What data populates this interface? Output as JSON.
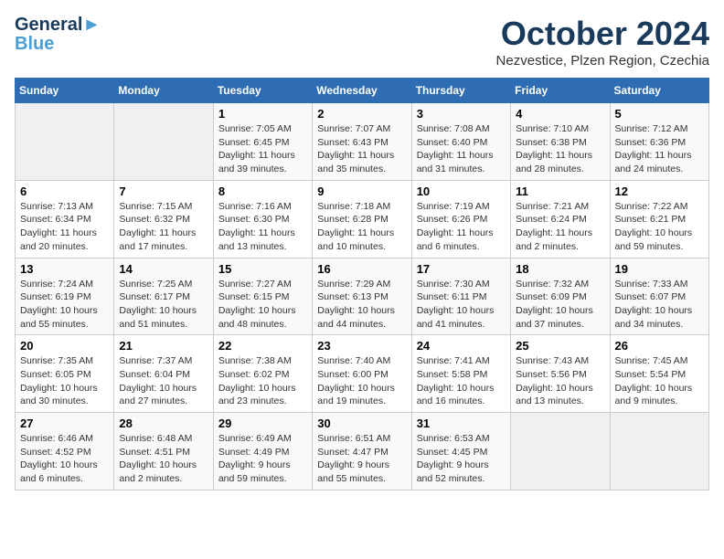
{
  "header": {
    "logo_line1": "General",
    "logo_line2": "Blue",
    "month": "October 2024",
    "location": "Nezvestice, Plzen Region, Czechia"
  },
  "weekdays": [
    "Sunday",
    "Monday",
    "Tuesday",
    "Wednesday",
    "Thursday",
    "Friday",
    "Saturday"
  ],
  "weeks": [
    [
      {
        "day": null
      },
      {
        "day": null
      },
      {
        "day": "1",
        "sunrise": "Sunrise: 7:05 AM",
        "sunset": "Sunset: 6:45 PM",
        "daylight": "Daylight: 11 hours and 39 minutes."
      },
      {
        "day": "2",
        "sunrise": "Sunrise: 7:07 AM",
        "sunset": "Sunset: 6:43 PM",
        "daylight": "Daylight: 11 hours and 35 minutes."
      },
      {
        "day": "3",
        "sunrise": "Sunrise: 7:08 AM",
        "sunset": "Sunset: 6:40 PM",
        "daylight": "Daylight: 11 hours and 31 minutes."
      },
      {
        "day": "4",
        "sunrise": "Sunrise: 7:10 AM",
        "sunset": "Sunset: 6:38 PM",
        "daylight": "Daylight: 11 hours and 28 minutes."
      },
      {
        "day": "5",
        "sunrise": "Sunrise: 7:12 AM",
        "sunset": "Sunset: 6:36 PM",
        "daylight": "Daylight: 11 hours and 24 minutes."
      }
    ],
    [
      {
        "day": "6",
        "sunrise": "Sunrise: 7:13 AM",
        "sunset": "Sunset: 6:34 PM",
        "daylight": "Daylight: 11 hours and 20 minutes."
      },
      {
        "day": "7",
        "sunrise": "Sunrise: 7:15 AM",
        "sunset": "Sunset: 6:32 PM",
        "daylight": "Daylight: 11 hours and 17 minutes."
      },
      {
        "day": "8",
        "sunrise": "Sunrise: 7:16 AM",
        "sunset": "Sunset: 6:30 PM",
        "daylight": "Daylight: 11 hours and 13 minutes."
      },
      {
        "day": "9",
        "sunrise": "Sunrise: 7:18 AM",
        "sunset": "Sunset: 6:28 PM",
        "daylight": "Daylight: 11 hours and 10 minutes."
      },
      {
        "day": "10",
        "sunrise": "Sunrise: 7:19 AM",
        "sunset": "Sunset: 6:26 PM",
        "daylight": "Daylight: 11 hours and 6 minutes."
      },
      {
        "day": "11",
        "sunrise": "Sunrise: 7:21 AM",
        "sunset": "Sunset: 6:24 PM",
        "daylight": "Daylight: 11 hours and 2 minutes."
      },
      {
        "day": "12",
        "sunrise": "Sunrise: 7:22 AM",
        "sunset": "Sunset: 6:21 PM",
        "daylight": "Daylight: 10 hours and 59 minutes."
      }
    ],
    [
      {
        "day": "13",
        "sunrise": "Sunrise: 7:24 AM",
        "sunset": "Sunset: 6:19 PM",
        "daylight": "Daylight: 10 hours and 55 minutes."
      },
      {
        "day": "14",
        "sunrise": "Sunrise: 7:25 AM",
        "sunset": "Sunset: 6:17 PM",
        "daylight": "Daylight: 10 hours and 51 minutes."
      },
      {
        "day": "15",
        "sunrise": "Sunrise: 7:27 AM",
        "sunset": "Sunset: 6:15 PM",
        "daylight": "Daylight: 10 hours and 48 minutes."
      },
      {
        "day": "16",
        "sunrise": "Sunrise: 7:29 AM",
        "sunset": "Sunset: 6:13 PM",
        "daylight": "Daylight: 10 hours and 44 minutes."
      },
      {
        "day": "17",
        "sunrise": "Sunrise: 7:30 AM",
        "sunset": "Sunset: 6:11 PM",
        "daylight": "Daylight: 10 hours and 41 minutes."
      },
      {
        "day": "18",
        "sunrise": "Sunrise: 7:32 AM",
        "sunset": "Sunset: 6:09 PM",
        "daylight": "Daylight: 10 hours and 37 minutes."
      },
      {
        "day": "19",
        "sunrise": "Sunrise: 7:33 AM",
        "sunset": "Sunset: 6:07 PM",
        "daylight": "Daylight: 10 hours and 34 minutes."
      }
    ],
    [
      {
        "day": "20",
        "sunrise": "Sunrise: 7:35 AM",
        "sunset": "Sunset: 6:05 PM",
        "daylight": "Daylight: 10 hours and 30 minutes."
      },
      {
        "day": "21",
        "sunrise": "Sunrise: 7:37 AM",
        "sunset": "Sunset: 6:04 PM",
        "daylight": "Daylight: 10 hours and 27 minutes."
      },
      {
        "day": "22",
        "sunrise": "Sunrise: 7:38 AM",
        "sunset": "Sunset: 6:02 PM",
        "daylight": "Daylight: 10 hours and 23 minutes."
      },
      {
        "day": "23",
        "sunrise": "Sunrise: 7:40 AM",
        "sunset": "Sunset: 6:00 PM",
        "daylight": "Daylight: 10 hours and 19 minutes."
      },
      {
        "day": "24",
        "sunrise": "Sunrise: 7:41 AM",
        "sunset": "Sunset: 5:58 PM",
        "daylight": "Daylight: 10 hours and 16 minutes."
      },
      {
        "day": "25",
        "sunrise": "Sunrise: 7:43 AM",
        "sunset": "Sunset: 5:56 PM",
        "daylight": "Daylight: 10 hours and 13 minutes."
      },
      {
        "day": "26",
        "sunrise": "Sunrise: 7:45 AM",
        "sunset": "Sunset: 5:54 PM",
        "daylight": "Daylight: 10 hours and 9 minutes."
      }
    ],
    [
      {
        "day": "27",
        "sunrise": "Sunrise: 6:46 AM",
        "sunset": "Sunset: 4:52 PM",
        "daylight": "Daylight: 10 hours and 6 minutes."
      },
      {
        "day": "28",
        "sunrise": "Sunrise: 6:48 AM",
        "sunset": "Sunset: 4:51 PM",
        "daylight": "Daylight: 10 hours and 2 minutes."
      },
      {
        "day": "29",
        "sunrise": "Sunrise: 6:49 AM",
        "sunset": "Sunset: 4:49 PM",
        "daylight": "Daylight: 9 hours and 59 minutes."
      },
      {
        "day": "30",
        "sunrise": "Sunrise: 6:51 AM",
        "sunset": "Sunset: 4:47 PM",
        "daylight": "Daylight: 9 hours and 55 minutes."
      },
      {
        "day": "31",
        "sunrise": "Sunrise: 6:53 AM",
        "sunset": "Sunset: 4:45 PM",
        "daylight": "Daylight: 9 hours and 52 minutes."
      },
      {
        "day": null
      },
      {
        "day": null
      }
    ]
  ]
}
